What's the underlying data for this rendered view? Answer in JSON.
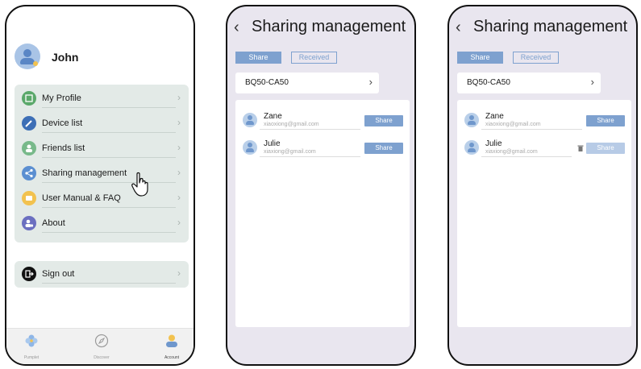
{
  "phone1": {
    "username": "John",
    "menu": [
      {
        "label": "My Profile",
        "icon": "profile-card-icon",
        "color": "#5aa86a"
      },
      {
        "label": "Device list",
        "icon": "wrench-icon",
        "color": "#3d6fb6"
      },
      {
        "label": "Friends list",
        "icon": "friends-icon",
        "color": "#78b98a"
      },
      {
        "label": "Sharing management",
        "icon": "share-icon",
        "color": "#5b8fd1"
      },
      {
        "label": "User Manual & FAQ",
        "icon": "chat-icon",
        "color": "#f2c24f"
      },
      {
        "label": "About",
        "icon": "about-icon",
        "color": "#6b6fc0"
      }
    ],
    "signout": {
      "label": "Sign out",
      "icon": "sign-out-icon",
      "color": "#111111"
    },
    "tabs": [
      {
        "label": "Pumplet",
        "icon": "fan-icon"
      },
      {
        "label": "Discover",
        "icon": "compass-icon"
      },
      {
        "label": "Account",
        "icon": "account-icon"
      }
    ]
  },
  "sharing": {
    "title": "Sharing management",
    "back_icon": "back-chevron-icon",
    "tab_share": "Share",
    "tab_received": "Received",
    "device": "BQ50-CA50",
    "users": [
      {
        "name": "Zane",
        "email": "xiaoxiong@gmail.com",
        "action": "Share"
      },
      {
        "name": "Julie",
        "email": "xiaxiong@gmail.com",
        "action": "Share"
      }
    ]
  },
  "colors": {
    "accent": "#7ea1cf",
    "menu_bg": "#e3eae7",
    "screen_bg": "#e9e6ef"
  }
}
